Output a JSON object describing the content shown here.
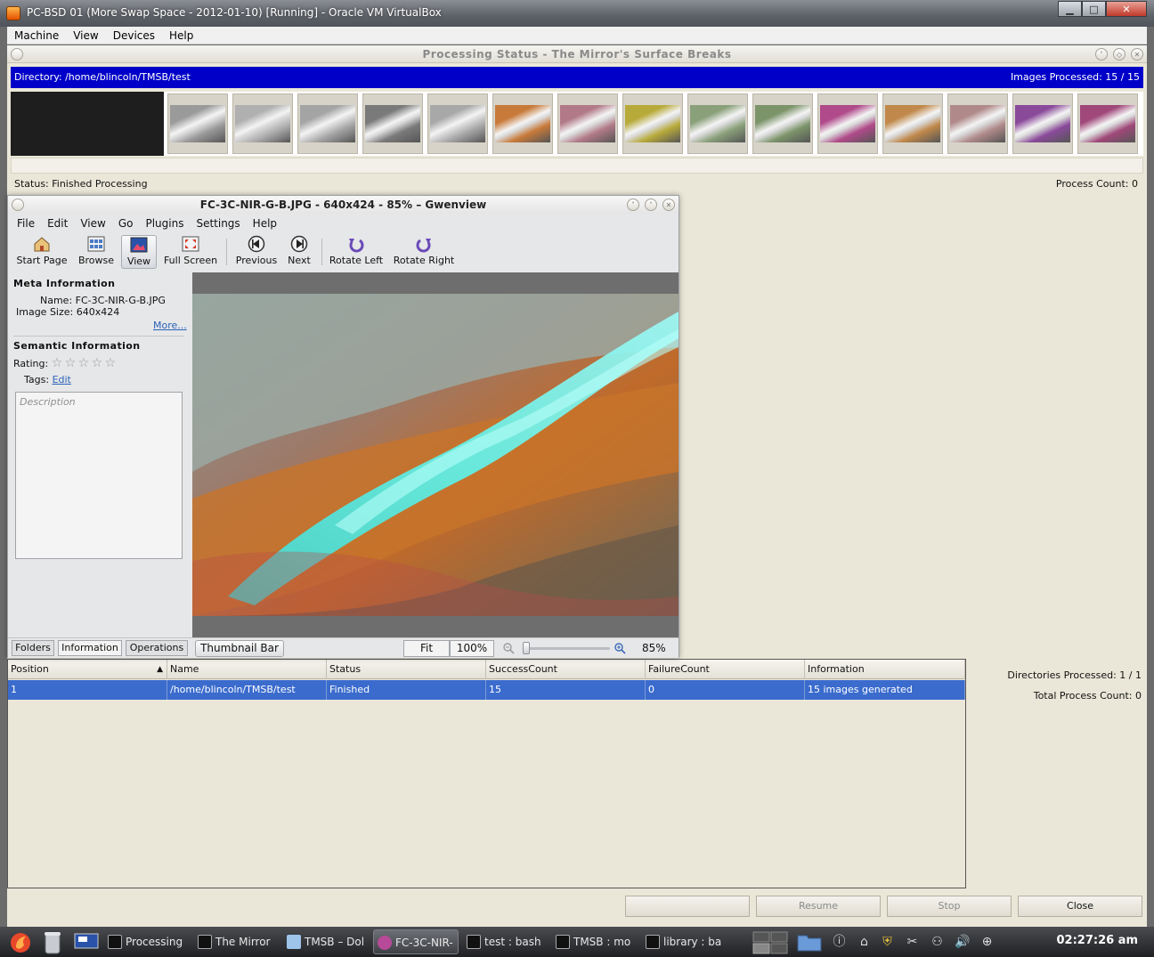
{
  "vbox": {
    "title": "PC-BSD 01 (More Swap Space - 2012-01-10) [Running] - Oracle VM VirtualBox",
    "menu": [
      "Machine",
      "View",
      "Devices",
      "Help"
    ]
  },
  "processing": {
    "title": "Processing Status - The Mirror's Surface Breaks",
    "directory": "Directory: /home/blincoln/TMSB/test",
    "images_processed": "Images Processed: 15 / 15",
    "status": "Status: Finished Processing",
    "process_count": "Process Count: 0",
    "thumbnails": [
      {
        "name": "gray-1",
        "color": "#9a9a9a"
      },
      {
        "name": "gray-2",
        "color": "#b0b0b0"
      },
      {
        "name": "gray-3",
        "color": "#a4a4a4"
      },
      {
        "name": "gray-4",
        "color": "#7a7a7a"
      },
      {
        "name": "gray-5",
        "color": "#a8a8a8"
      },
      {
        "name": "cyan-orange",
        "color": "#c87a3a"
      },
      {
        "name": "cyan-magenta",
        "color": "#b27a88"
      },
      {
        "name": "cyan-yellow",
        "color": "#b8aa3a"
      },
      {
        "name": "cyan-green",
        "color": "#8aa07a"
      },
      {
        "name": "cyan-olive",
        "color": "#7c946a"
      },
      {
        "name": "magenta",
        "color": "#b04a8a"
      },
      {
        "name": "amber",
        "color": "#c0884a"
      },
      {
        "name": "rose",
        "color": "#b08a8a"
      },
      {
        "name": "purple",
        "color": "#8a4a9a"
      },
      {
        "name": "magenta-cyan",
        "color": "#a0487a"
      }
    ],
    "table": {
      "columns": [
        "Position",
        "Name",
        "Status",
        "SuccessCount",
        "FailureCount",
        "Information"
      ],
      "rows": [
        [
          "1",
          "/home/blincoln/TMSB/test",
          "Finished",
          "15",
          "0",
          "15 images generated"
        ]
      ]
    },
    "directories_processed": "Directories Processed: 1 / 1",
    "total_process_count": "Total Process Count: 0",
    "buttons": {
      "blank": "",
      "resume": "Resume",
      "stop": "Stop",
      "close": "Close"
    }
  },
  "gwenview": {
    "title": "FC-3C-NIR-G-B.JPG - 640x424 - 85% – Gwenview",
    "menu": [
      "File",
      "Edit",
      "View",
      "Go",
      "Plugins",
      "Settings",
      "Help"
    ],
    "toolbar": {
      "start_page": "Start Page",
      "browse": "Browse",
      "view": "View",
      "full_screen": "Full Screen",
      "previous": "Previous",
      "next": "Next",
      "rotate_left": "Rotate Left",
      "rotate_right": "Rotate Right"
    },
    "meta": {
      "heading": "Meta Information",
      "name_label": "Name:",
      "name_value": "FC-3C-NIR-G-B.JPG",
      "size_label": "Image Size:",
      "size_value": "640x424",
      "more": "More..."
    },
    "semantic": {
      "heading": "Semantic Information",
      "rating_label": "Rating:",
      "rating": 0,
      "tags_label": "Tags:",
      "tags_edit": "Edit",
      "description_placeholder": "Description"
    },
    "side_tabs": [
      "Folders",
      "Information",
      "Operations"
    ],
    "thumbnail_bar": "Thumbnail Bar",
    "fit": "Fit",
    "zoom_100": "100%",
    "zoom_level": "85%",
    "zoom_slider_fraction": 0.0
  },
  "taskbar": {
    "tasks": [
      "Processing",
      "The Mirror",
      "TMSB – Dol",
      "FC-3C-NIR-",
      "test : bash",
      "TMSB : mo",
      "library : ba"
    ],
    "clock": "02:27:26 am"
  }
}
